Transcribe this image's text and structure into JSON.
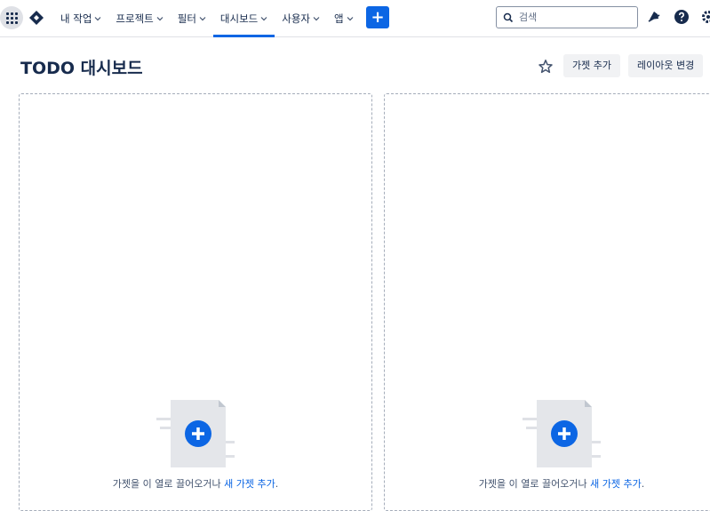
{
  "nav": {
    "items": [
      {
        "label": "내 작업",
        "active": false
      },
      {
        "label": "프로젝트",
        "active": false
      },
      {
        "label": "필터",
        "active": false
      },
      {
        "label": "대시보드",
        "active": true
      },
      {
        "label": "사용자",
        "active": false
      },
      {
        "label": "앱",
        "active": false
      }
    ],
    "create_label": "+",
    "search_placeholder": "검색"
  },
  "page": {
    "title": "TODO 대시보드",
    "add_gadget_label": "가젯 추가",
    "change_layout_label": "레이아웃 변경"
  },
  "columns": [
    {
      "hint_text": "가젯을 이 열로 끌어오거나 ",
      "hint_link": "새 가젯 추가",
      "hint_end": "."
    },
    {
      "hint_text": "가젯을 이 열로 끌어오거나 ",
      "hint_link": "새 가젯 추가",
      "hint_end": "."
    }
  ],
  "colors": {
    "accent": "#0c66e4",
    "text": "#172b4d",
    "border": "#a5adba"
  }
}
